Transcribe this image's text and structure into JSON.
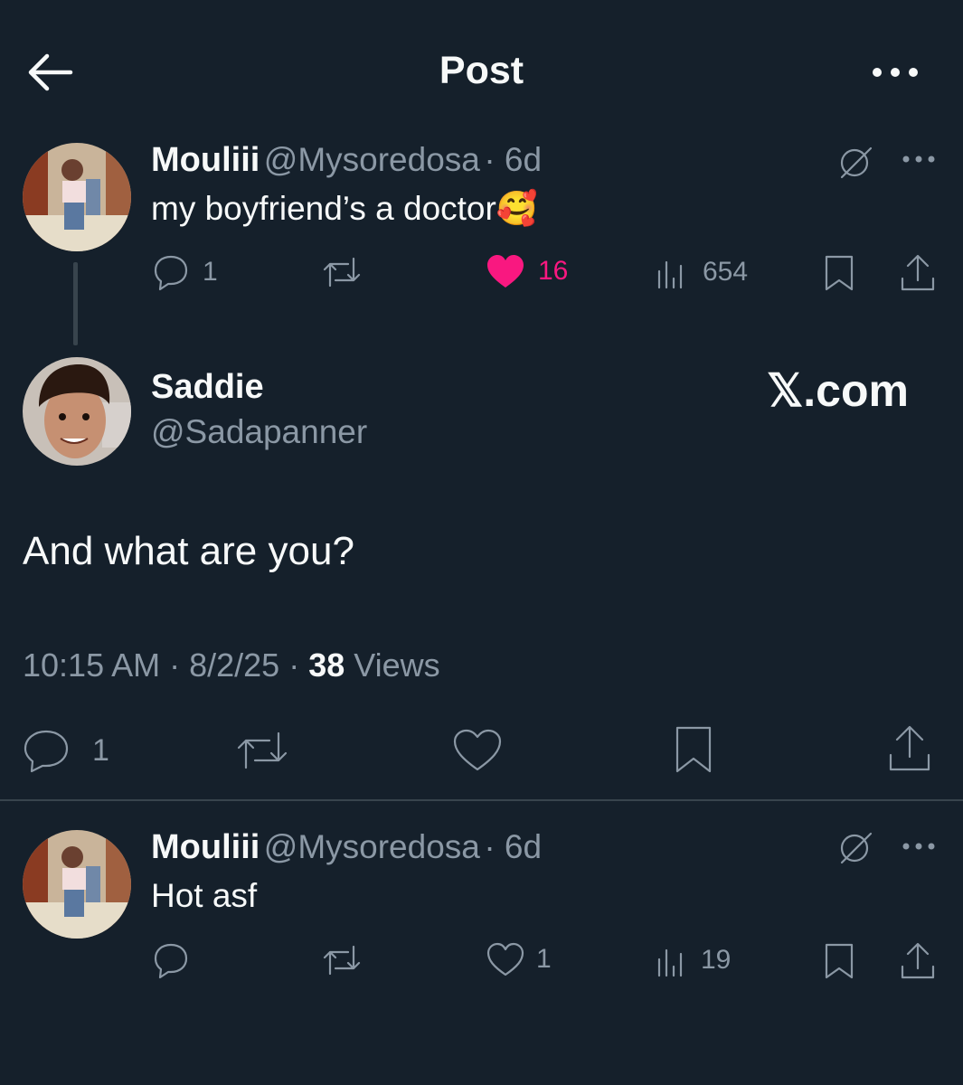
{
  "header": {
    "title": "Post"
  },
  "reply_parent": {
    "author_name": "Mouliii",
    "author_handle": "@Mysoredosa",
    "time": "· 6d",
    "text": "my boyfriend’s a doctor🥰",
    "replies": "1",
    "likes": "16",
    "views": "654",
    "like_color": "#f91880"
  },
  "main_post": {
    "author_name": "Saddie",
    "author_handle": "@Sadapanner",
    "watermark": "𝕏.com",
    "text": "And what are you?",
    "time": "10:15 AM",
    "date": "· 8/2/25 ·",
    "views_count": "38",
    "views_label": "Views",
    "replies": "1"
  },
  "reply": {
    "author_name": "Mouliii",
    "author_handle": "@Mysoredosa",
    "time": "· 6d",
    "text": "Hot asf",
    "likes": "1",
    "views": "19"
  },
  "colors": {
    "background": "#15202b",
    "muted": "#8b98a5",
    "like": "#f91880",
    "divider": "#38444d"
  }
}
